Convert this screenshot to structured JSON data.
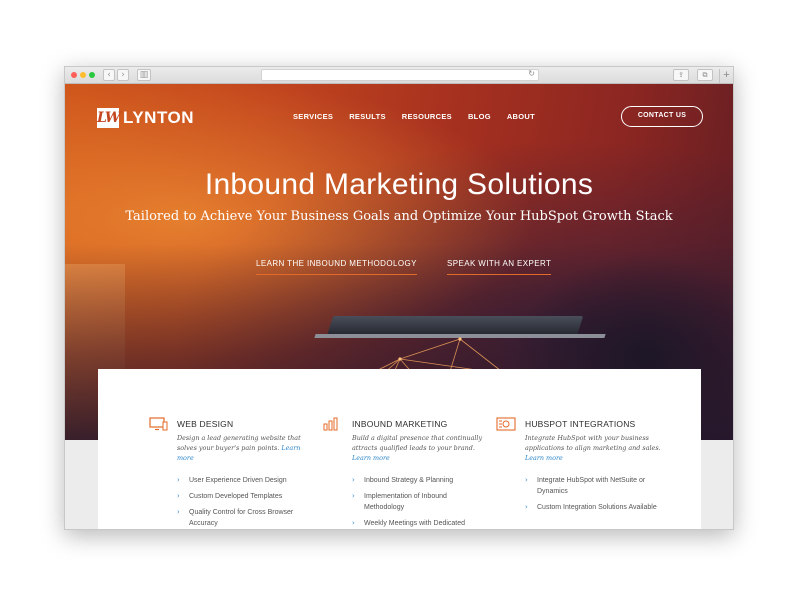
{
  "browser": {
    "back_icon": "‹",
    "forward_icon": "›",
    "sidebar_icon": "▥",
    "reload_icon": "↻",
    "share_icon": "⇪",
    "tabs_icon": "⧉",
    "new_tab_icon": "+"
  },
  "brand": {
    "logo_mark": "LW",
    "name": "LYNTON",
    "accent": "#e36b2a",
    "link": "#2d86c9"
  },
  "nav": {
    "items": [
      "SERVICES",
      "RESULTS",
      "RESOURCES",
      "BLOG",
      "ABOUT"
    ],
    "contact_label": "CONTACT US"
  },
  "hero": {
    "title": "Inbound Marketing Solutions",
    "subtitle": "Tailored to Achieve Your Business Goals and Optimize Your HubSpot Growth Stack",
    "cta_left": "LEARN THE INBOUND METHODOLOGY",
    "cta_right": "SPEAK WITH AN EXPERT"
  },
  "services": [
    {
      "icon": "monitor-icon",
      "title": "WEB DESIGN",
      "description": "Design a lead generating website that solves your buyer's pain points.",
      "more": "Learn more",
      "bullets": [
        "User Experience Driven Design",
        "Custom Developed Templates",
        "Quality Control for Cross Browser Accuracy"
      ]
    },
    {
      "icon": "bar-chart-icon",
      "title": "INBOUND MARKETING",
      "description": "Build a digital presence that continually attracts qualified leads to your brand.",
      "more": "Learn more",
      "bullets": [
        "Inbound Strategy & Planning",
        "Implementation of Inbound Methodology",
        "Weekly Meetings with Dedicated"
      ]
    },
    {
      "icon": "integration-icon",
      "title": "HUBSPOT INTEGRATIONS",
      "description": "Integrate HubSpot with your business applications to align marketing and sales.",
      "more": "Learn more",
      "bullets": [
        "Integrate HubSpot with NetSuite or Dynamics",
        "Custom Integration Solutions Available"
      ]
    }
  ]
}
